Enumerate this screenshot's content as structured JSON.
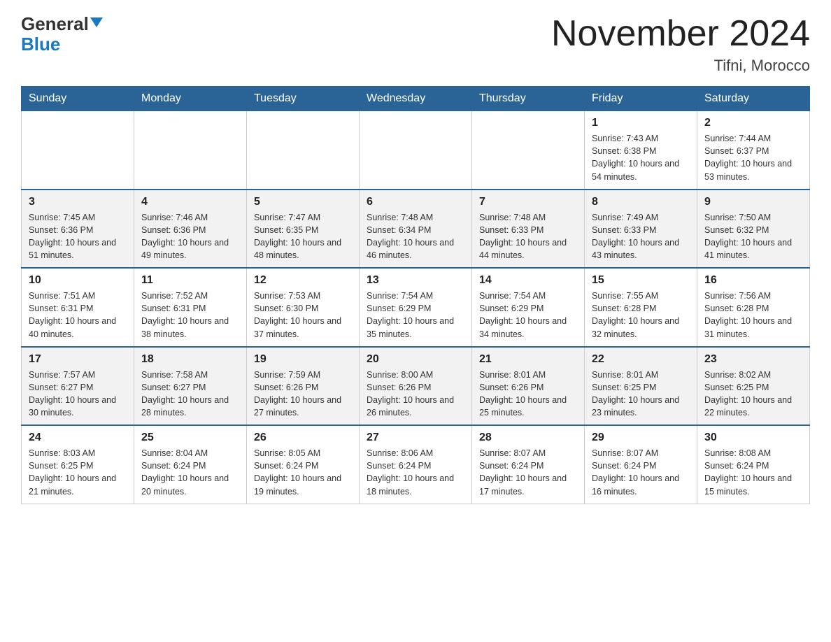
{
  "header": {
    "logo_general": "General",
    "logo_blue": "Blue",
    "month_title": "November 2024",
    "location": "Tifni, Morocco"
  },
  "days_of_week": [
    "Sunday",
    "Monday",
    "Tuesday",
    "Wednesday",
    "Thursday",
    "Friday",
    "Saturday"
  ],
  "weeks": [
    [
      {
        "day": "",
        "info": ""
      },
      {
        "day": "",
        "info": ""
      },
      {
        "day": "",
        "info": ""
      },
      {
        "day": "",
        "info": ""
      },
      {
        "day": "",
        "info": ""
      },
      {
        "day": "1",
        "info": "Sunrise: 7:43 AM\nSunset: 6:38 PM\nDaylight: 10 hours and 54 minutes."
      },
      {
        "day": "2",
        "info": "Sunrise: 7:44 AM\nSunset: 6:37 PM\nDaylight: 10 hours and 53 minutes."
      }
    ],
    [
      {
        "day": "3",
        "info": "Sunrise: 7:45 AM\nSunset: 6:36 PM\nDaylight: 10 hours and 51 minutes."
      },
      {
        "day": "4",
        "info": "Sunrise: 7:46 AM\nSunset: 6:36 PM\nDaylight: 10 hours and 49 minutes."
      },
      {
        "day": "5",
        "info": "Sunrise: 7:47 AM\nSunset: 6:35 PM\nDaylight: 10 hours and 48 minutes."
      },
      {
        "day": "6",
        "info": "Sunrise: 7:48 AM\nSunset: 6:34 PM\nDaylight: 10 hours and 46 minutes."
      },
      {
        "day": "7",
        "info": "Sunrise: 7:48 AM\nSunset: 6:33 PM\nDaylight: 10 hours and 44 minutes."
      },
      {
        "day": "8",
        "info": "Sunrise: 7:49 AM\nSunset: 6:33 PM\nDaylight: 10 hours and 43 minutes."
      },
      {
        "day": "9",
        "info": "Sunrise: 7:50 AM\nSunset: 6:32 PM\nDaylight: 10 hours and 41 minutes."
      }
    ],
    [
      {
        "day": "10",
        "info": "Sunrise: 7:51 AM\nSunset: 6:31 PM\nDaylight: 10 hours and 40 minutes."
      },
      {
        "day": "11",
        "info": "Sunrise: 7:52 AM\nSunset: 6:31 PM\nDaylight: 10 hours and 38 minutes."
      },
      {
        "day": "12",
        "info": "Sunrise: 7:53 AM\nSunset: 6:30 PM\nDaylight: 10 hours and 37 minutes."
      },
      {
        "day": "13",
        "info": "Sunrise: 7:54 AM\nSunset: 6:29 PM\nDaylight: 10 hours and 35 minutes."
      },
      {
        "day": "14",
        "info": "Sunrise: 7:54 AM\nSunset: 6:29 PM\nDaylight: 10 hours and 34 minutes."
      },
      {
        "day": "15",
        "info": "Sunrise: 7:55 AM\nSunset: 6:28 PM\nDaylight: 10 hours and 32 minutes."
      },
      {
        "day": "16",
        "info": "Sunrise: 7:56 AM\nSunset: 6:28 PM\nDaylight: 10 hours and 31 minutes."
      }
    ],
    [
      {
        "day": "17",
        "info": "Sunrise: 7:57 AM\nSunset: 6:27 PM\nDaylight: 10 hours and 30 minutes."
      },
      {
        "day": "18",
        "info": "Sunrise: 7:58 AM\nSunset: 6:27 PM\nDaylight: 10 hours and 28 minutes."
      },
      {
        "day": "19",
        "info": "Sunrise: 7:59 AM\nSunset: 6:26 PM\nDaylight: 10 hours and 27 minutes."
      },
      {
        "day": "20",
        "info": "Sunrise: 8:00 AM\nSunset: 6:26 PM\nDaylight: 10 hours and 26 minutes."
      },
      {
        "day": "21",
        "info": "Sunrise: 8:01 AM\nSunset: 6:26 PM\nDaylight: 10 hours and 25 minutes."
      },
      {
        "day": "22",
        "info": "Sunrise: 8:01 AM\nSunset: 6:25 PM\nDaylight: 10 hours and 23 minutes."
      },
      {
        "day": "23",
        "info": "Sunrise: 8:02 AM\nSunset: 6:25 PM\nDaylight: 10 hours and 22 minutes."
      }
    ],
    [
      {
        "day": "24",
        "info": "Sunrise: 8:03 AM\nSunset: 6:25 PM\nDaylight: 10 hours and 21 minutes."
      },
      {
        "day": "25",
        "info": "Sunrise: 8:04 AM\nSunset: 6:24 PM\nDaylight: 10 hours and 20 minutes."
      },
      {
        "day": "26",
        "info": "Sunrise: 8:05 AM\nSunset: 6:24 PM\nDaylight: 10 hours and 19 minutes."
      },
      {
        "day": "27",
        "info": "Sunrise: 8:06 AM\nSunset: 6:24 PM\nDaylight: 10 hours and 18 minutes."
      },
      {
        "day": "28",
        "info": "Sunrise: 8:07 AM\nSunset: 6:24 PM\nDaylight: 10 hours and 17 minutes."
      },
      {
        "day": "29",
        "info": "Sunrise: 8:07 AM\nSunset: 6:24 PM\nDaylight: 10 hours and 16 minutes."
      },
      {
        "day": "30",
        "info": "Sunrise: 8:08 AM\nSunset: 6:24 PM\nDaylight: 10 hours and 15 minutes."
      }
    ]
  ]
}
